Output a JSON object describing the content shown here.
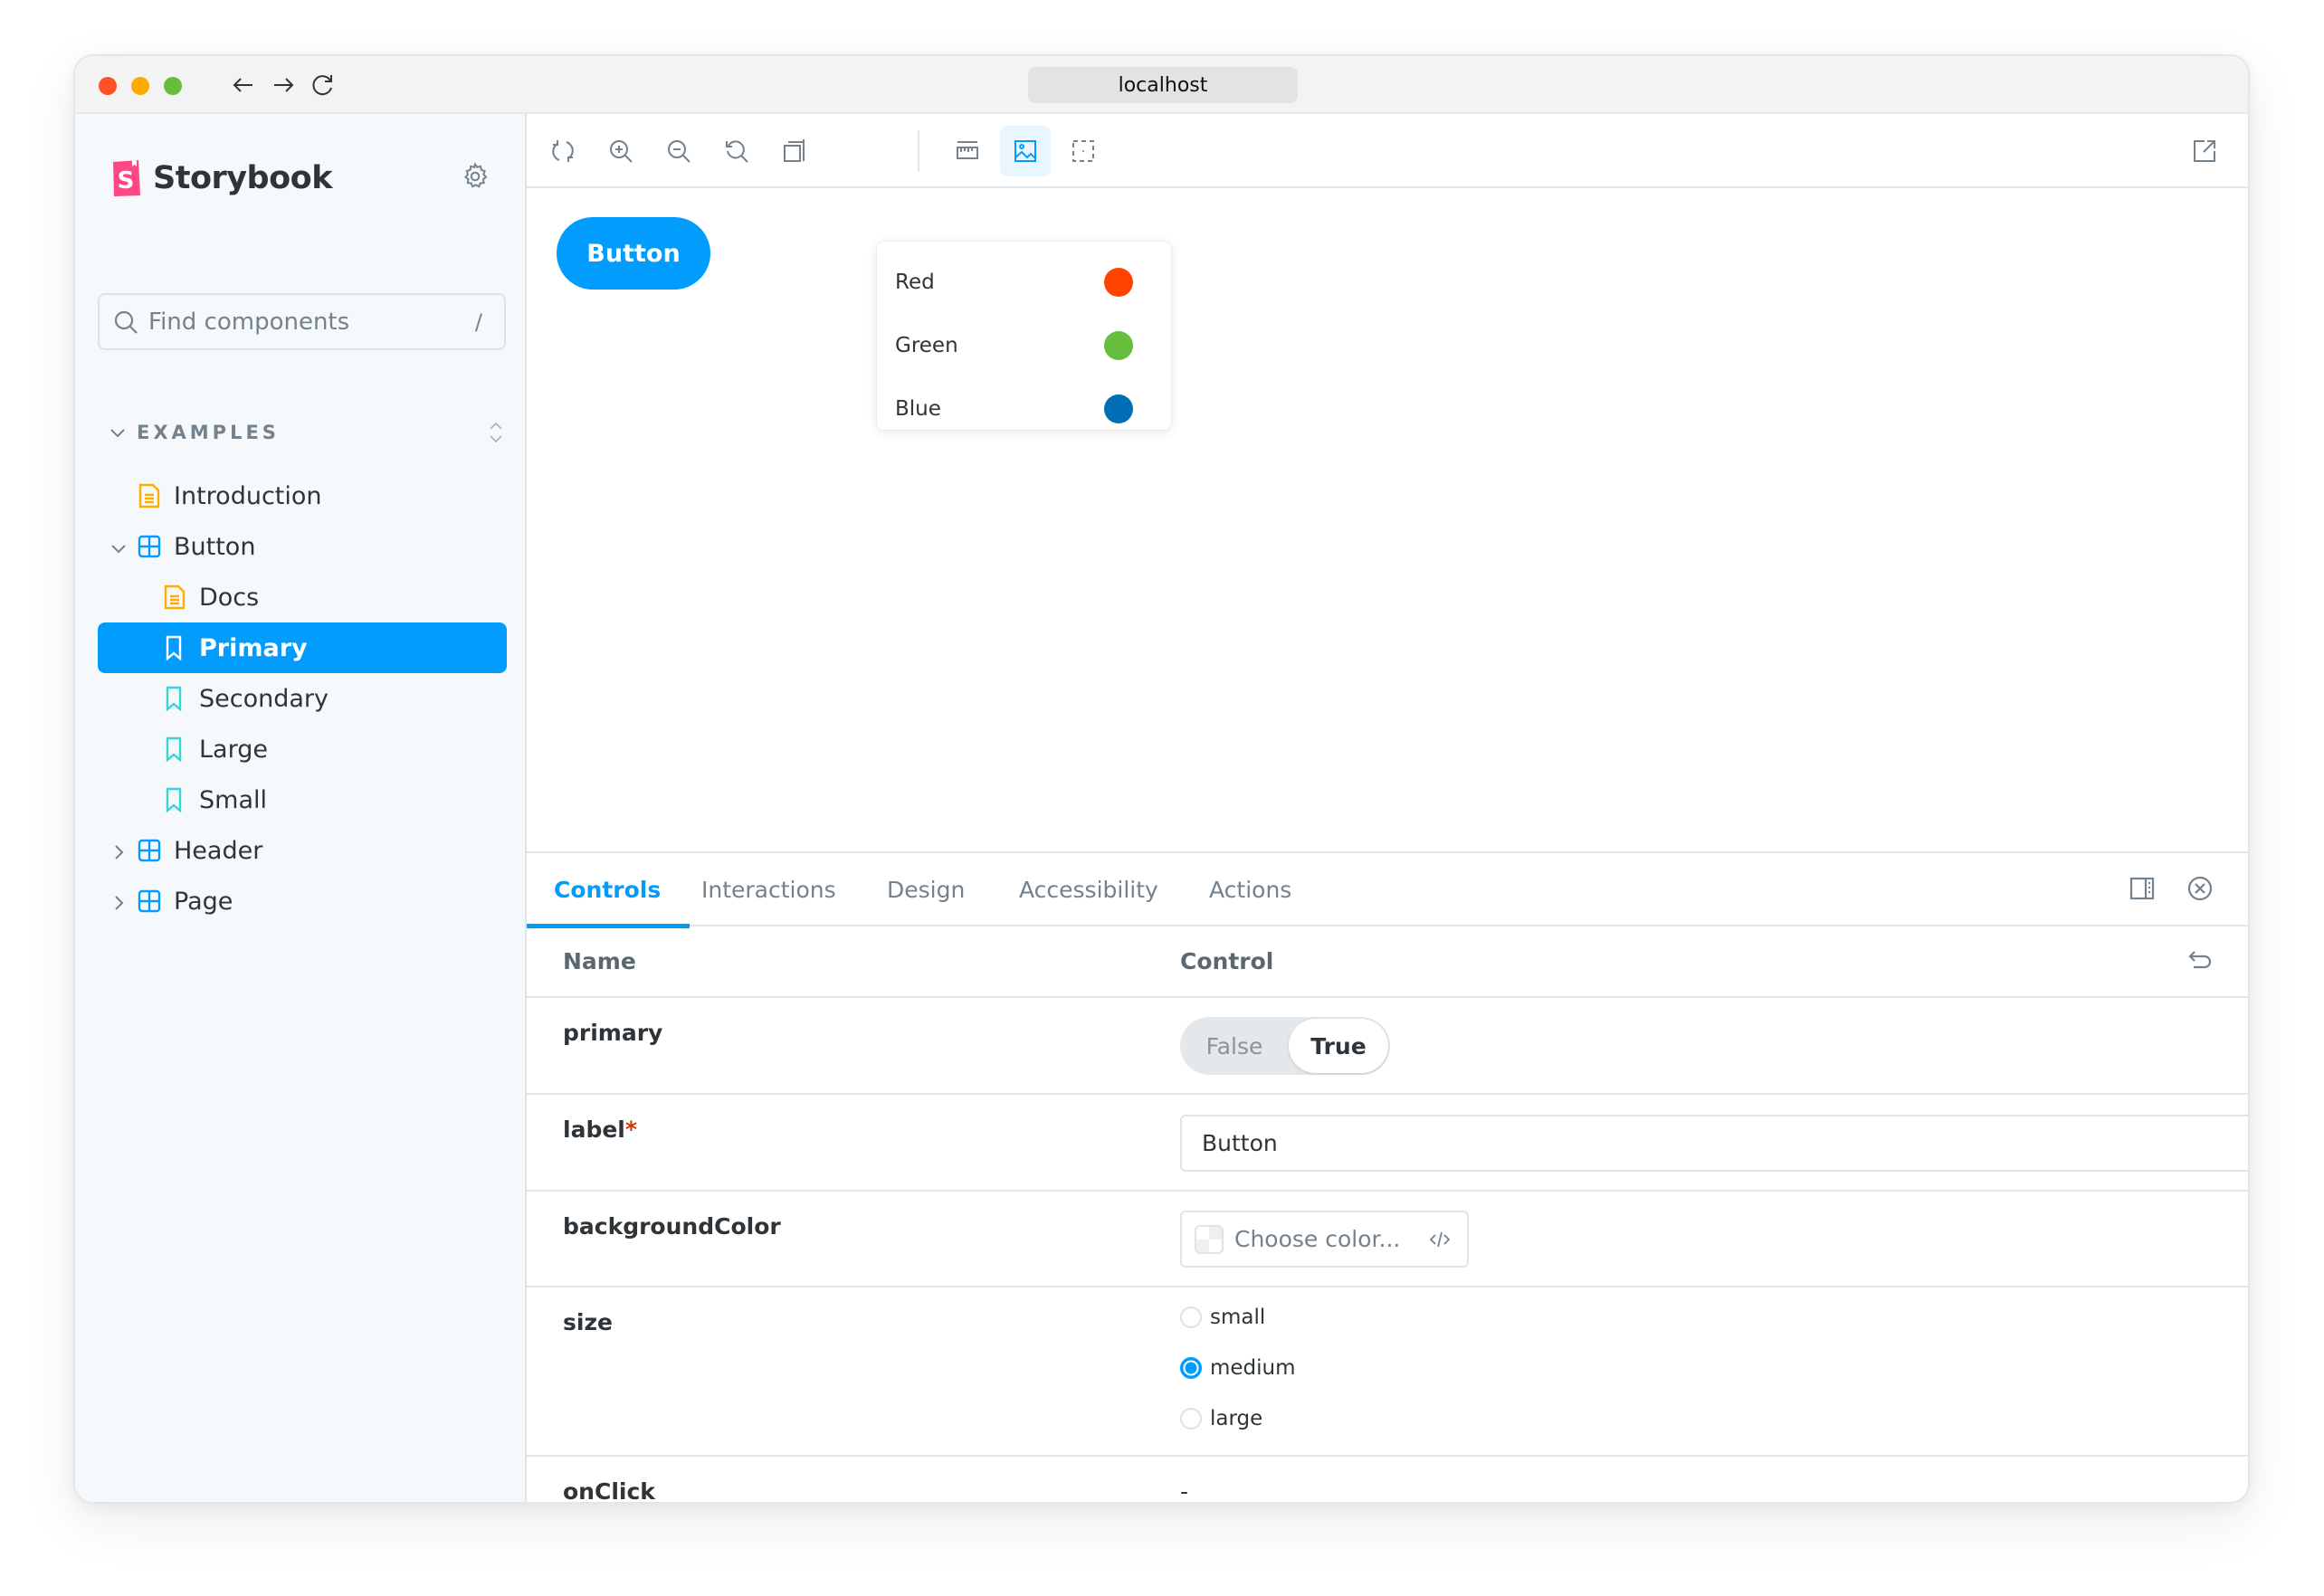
{
  "browser": {
    "url": "localhost"
  },
  "sidebar": {
    "brand": "Storybook",
    "search_placeholder": "Find components",
    "search_shortcut": "/",
    "section_label": "EXAMPLES",
    "items": [
      {
        "label": "Introduction",
        "type": "docs",
        "level": 1
      },
      {
        "label": "Button",
        "type": "component",
        "level": 1,
        "expanded": true
      },
      {
        "label": "Docs",
        "type": "docs",
        "level": 2
      },
      {
        "label": "Primary",
        "type": "story",
        "level": 2,
        "selected": true
      },
      {
        "label": "Secondary",
        "type": "story",
        "level": 2
      },
      {
        "label": "Large",
        "type": "story",
        "level": 2
      },
      {
        "label": "Small",
        "type": "story",
        "level": 2
      },
      {
        "label": "Header",
        "type": "component",
        "level": 1,
        "expanded": false
      },
      {
        "label": "Page",
        "type": "component",
        "level": 1,
        "expanded": false
      }
    ]
  },
  "toolbar": {
    "tools": [
      "reload-icon",
      "zoom-in-icon",
      "zoom-out-icon",
      "zoom-reset-icon",
      "viewport-icon",
      "measure-icon",
      "background-icon",
      "outline-icon"
    ],
    "active_tool": "background-icon",
    "open_new_tab_icon": "share-icon"
  },
  "backgrounds_menu": {
    "options": [
      {
        "label": "Red",
        "color": "#FF4400"
      },
      {
        "label": "Green",
        "color": "#66BF3C"
      },
      {
        "label": "Blue",
        "color": "#006DB5"
      }
    ]
  },
  "preview": {
    "button_label": "Button",
    "button_color": "#029CFD"
  },
  "panel": {
    "tabs": [
      "Controls",
      "Interactions",
      "Design",
      "Accessibility",
      "Actions"
    ],
    "active_tab": "Controls",
    "columns": {
      "name": "Name",
      "control": "Control"
    },
    "rows": {
      "primary": {
        "name": "primary",
        "false_label": "False",
        "true_label": "True",
        "value": true
      },
      "label": {
        "name": "label",
        "required": "*",
        "value": "Button"
      },
      "backgroundColor": {
        "name": "backgroundColor",
        "placeholder": "Choose color..."
      },
      "size": {
        "name": "size",
        "options": [
          "small",
          "medium",
          "large"
        ],
        "selected": "medium"
      },
      "onClick": {
        "name": "onClick",
        "value": "-"
      }
    }
  },
  "colors": {
    "accent": "#029CFD",
    "required": "#D43900"
  }
}
